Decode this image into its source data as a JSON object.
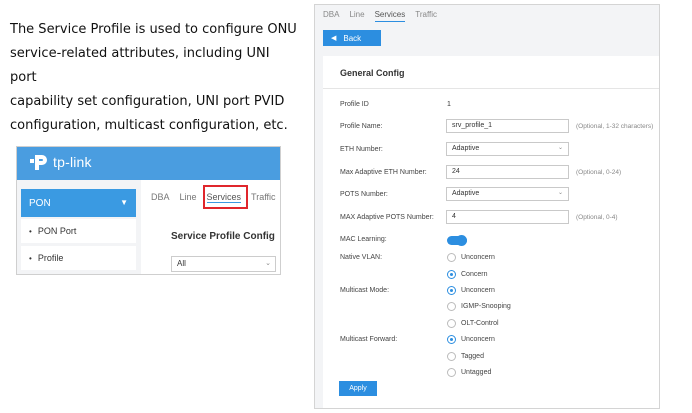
{
  "description": {
    "lines": [
      "The Service Profile is used to configure ONU",
      "service-related attributes, including UNI port",
      "capability set configuration, UNI port PVID",
      "configuration, multicast configuration, etc."
    ]
  },
  "mini": {
    "logo_text": "tp-link",
    "sidebar_group": "PON",
    "sidebar_items": [
      "PON Port",
      "Profile"
    ],
    "tabs": [
      "DBA",
      "Line",
      "Services",
      "Traffic"
    ],
    "active_tab": "Services",
    "title": "Service Profile Config",
    "select_value": "All"
  },
  "panel": {
    "tabs": [
      "DBA",
      "Line",
      "Services",
      "Traffic"
    ],
    "active_tab": "Services",
    "back_label": "Back",
    "section_title": "General Config",
    "rows": {
      "profile_id": {
        "label": "Profile ID",
        "value": "1"
      },
      "profile_name": {
        "label": "Profile Name:",
        "value": "srv_profile_1",
        "hint": "(Optional, 1-32 characters)"
      },
      "eth_number": {
        "label": "ETH Number:",
        "value": "Adaptive"
      },
      "max_adaptive_eth": {
        "label": "Max Adaptive ETH Number:",
        "value": "24",
        "hint": "(Optional, 0-24)"
      },
      "pots_number": {
        "label": "POTS Number:",
        "value": "Adaptive"
      },
      "max_adaptive_pots": {
        "label": "MAX Adaptive POTS Number:",
        "value": "4",
        "hint": "(Optional, 0-4)"
      },
      "mac_learning": {
        "label": "MAC Learning:",
        "enabled": true
      },
      "native_vlan": {
        "label": "Native VLAN:",
        "options": [
          "Unconcern",
          "Concern"
        ],
        "selected": "Concern"
      },
      "multicast_mode": {
        "label": "Multicast Mode:",
        "options": [
          "Unconcern",
          "IGMP-Snooping",
          "OLT-Control"
        ],
        "selected": "Unconcern"
      },
      "multicast_forward": {
        "label": "Multicast Forward:",
        "options": [
          "Unconcern",
          "Tagged",
          "Untagged"
        ],
        "selected": "Unconcern"
      }
    },
    "apply_label": "Apply"
  },
  "colors": {
    "accent": "#2c8ee0",
    "brand_header": "#4a9de0",
    "highlight_box": "#e0262c"
  }
}
